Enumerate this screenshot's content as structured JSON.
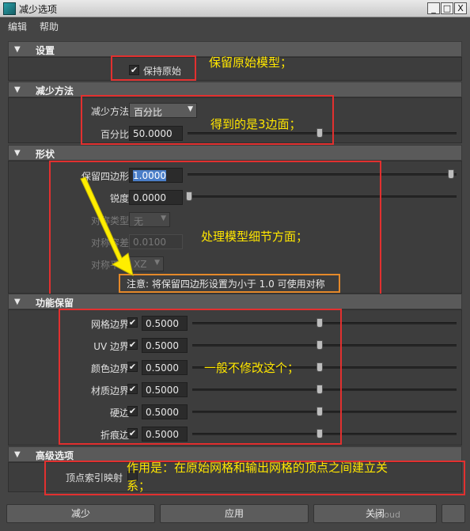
{
  "window": {
    "title": "减少选项",
    "min": "_",
    "max": "□",
    "close": "X"
  },
  "menu": {
    "items": [
      "编辑",
      "帮助"
    ]
  },
  "sections": {
    "settings": {
      "title": "设置",
      "keep_original_label": "保持原始",
      "keep_original_checked": true
    },
    "reduce_method": {
      "title": "减少方法",
      "method_label": "减少方法",
      "method_value": "百分比",
      "percent_label": "百分比",
      "percent_value": "50.0000",
      "percent_fraction": 0.5
    },
    "shape": {
      "title": "形状",
      "keep_quads_label": "保留四边形",
      "keep_quads_value": "1.0000",
      "keep_quads_fraction": 1.0,
      "sharpness_label": "锐度",
      "sharpness_value": "0.0000",
      "sharpness_fraction": 0.0,
      "sym_type_label": "对称类型",
      "sym_type_value": "无",
      "sym_tol_label": "对称容差",
      "sym_tol_value": "0.0100",
      "sym_plane_label": "对称平面",
      "sym_plane_value": "XZ",
      "note": "注意: 将保留四边形设置为小于 1.0 可使用对称"
    },
    "preserve": {
      "title": "功能保留",
      "rows": [
        {
          "label": "网格边界",
          "checked": true,
          "value": "0.5000",
          "fraction": 0.5
        },
        {
          "label": "UV 边界",
          "checked": true,
          "value": "0.5000",
          "fraction": 0.5
        },
        {
          "label": "颜色边界",
          "checked": true,
          "value": "0.5000",
          "fraction": 0.5
        },
        {
          "label": "材质边界",
          "checked": true,
          "value": "0.5000",
          "fraction": 0.5
        },
        {
          "label": "硬边",
          "checked": true,
          "value": "0.5000",
          "fraction": 0.5
        },
        {
          "label": "折痕边",
          "checked": true,
          "value": "0.5000",
          "fraction": 0.5
        }
      ]
    },
    "advanced": {
      "title": "高级选项",
      "vertex_map_label": "顶点索引映射"
    }
  },
  "annotations": {
    "keep_original": "保留原始模型；",
    "triangles": "得到的是3边面；",
    "detail": "处理模型细节方面；",
    "no_change": "一般不修改这个；",
    "advanced_line1": "作用是：在原始网格和输出网格的顶点之间建立关",
    "advanced_line2": "系；"
  },
  "buttons": {
    "reduce": "减少",
    "apply": "应用",
    "close": "关闭"
  },
  "watermark": "gxoud",
  "colors": {
    "annotation": "#ffe600",
    "highlight_box": "#e2302f",
    "note_box": "#e5892a",
    "arrow": "#ffee00"
  }
}
